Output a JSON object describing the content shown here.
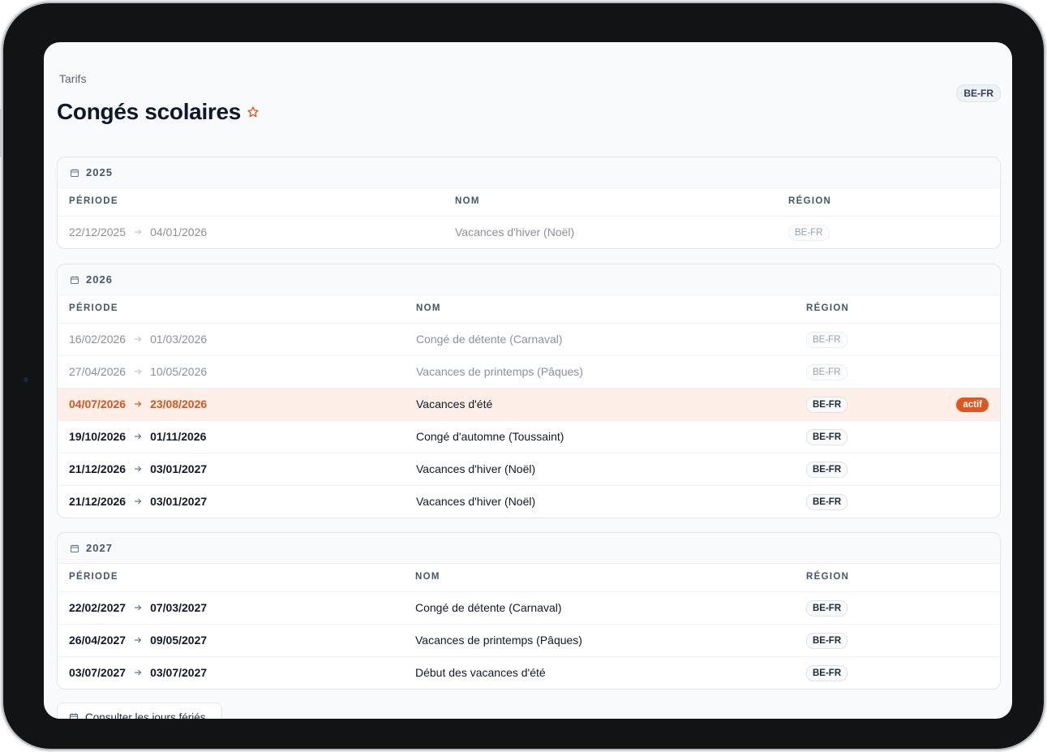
{
  "header": {
    "breadcrumb": "Tarifs",
    "title": "Congés scolaires",
    "region_badge": "BE-FR"
  },
  "columns": {
    "period": "PÉRIODE",
    "name": "NOM",
    "region": "RÉGION"
  },
  "years": [
    {
      "year": "2025",
      "rows": [
        {
          "start": "22/12/2025",
          "end": "04/01/2026",
          "name": "Vacances d'hiver (Noël)",
          "region": "BE-FR",
          "state": "past"
        }
      ]
    },
    {
      "year": "2026",
      "rows": [
        {
          "start": "16/02/2026",
          "end": "01/03/2026",
          "name": "Congé de détente (Carnaval)",
          "region": "BE-FR",
          "state": "past"
        },
        {
          "start": "27/04/2026",
          "end": "10/05/2026",
          "name": "Vacances de printemps (Pâques)",
          "region": "BE-FR",
          "state": "past"
        },
        {
          "start": "04/07/2026",
          "end": "23/08/2026",
          "name": "Vacances d'été",
          "region": "BE-FR",
          "state": "active",
          "status": "actif"
        },
        {
          "start": "19/10/2026",
          "end": "01/11/2026",
          "name": "Congé d'automne (Toussaint)",
          "region": "BE-FR",
          "state": "upcoming"
        },
        {
          "start": "21/12/2026",
          "end": "03/01/2027",
          "name": "Vacances d'hiver (Noël)",
          "region": "BE-FR",
          "state": "upcoming"
        },
        {
          "start": "21/12/2026",
          "end": "03/01/2027",
          "name": "Vacances d'hiver (Noël)",
          "region": "BE-FR",
          "state": "upcoming"
        }
      ]
    },
    {
      "year": "2027",
      "rows": [
        {
          "start": "22/02/2027",
          "end": "07/03/2027",
          "name": "Congé de détente (Carnaval)",
          "region": "BE-FR",
          "state": "upcoming"
        },
        {
          "start": "26/04/2027",
          "end": "09/05/2027",
          "name": "Vacances de printemps (Pâques)",
          "region": "BE-FR",
          "state": "upcoming"
        },
        {
          "start": "03/07/2027",
          "end": "03/07/2027",
          "name": "Début des vacances d'été",
          "region": "BE-FR",
          "state": "upcoming"
        }
      ]
    }
  ],
  "footer": {
    "holidays_button": "Consulter les jours fériés"
  },
  "colors": {
    "accent": "#e0561f",
    "active_row": "#fdeee7",
    "title": "#0f172a"
  }
}
